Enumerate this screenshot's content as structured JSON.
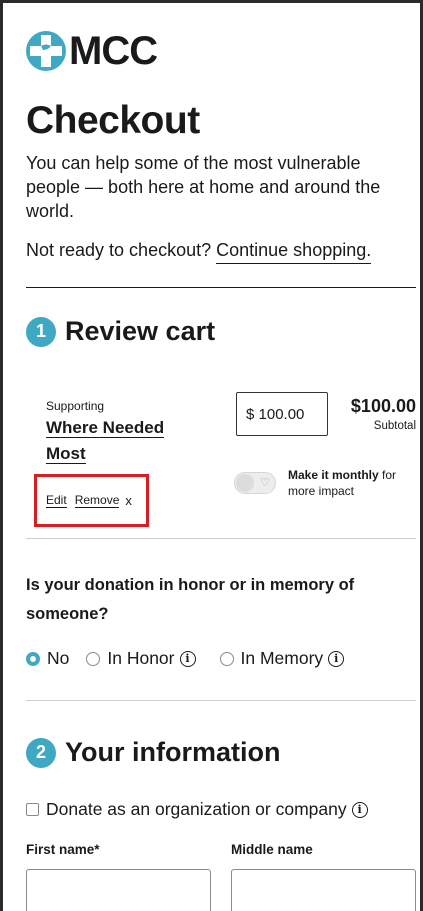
{
  "brand": {
    "name": "MCC",
    "logo_icon": "mcc-dove-cross-icon",
    "accent_color": "#3fa9c4",
    "highlight_color": "#d81e24"
  },
  "page": {
    "title": "Checkout",
    "intro": "You can help some of the most vulnerable people — both here at home and around the world.",
    "not_ready_text": "Not ready to checkout?",
    "continue_link": "Continue shopping."
  },
  "review_cart": {
    "step_number": "1",
    "title": "Review cart",
    "item": {
      "supporting_label": "Supporting",
      "fund_name": "Where Needed Most",
      "amount_input": "$ 100.00",
      "amount_total": "$100.00",
      "subtotal_label": "Subtotal",
      "edit_label": "Edit",
      "remove_label": "Remove",
      "remove_x": "x",
      "monthly_toggle": {
        "on": false,
        "icon": "heart-icon"
      },
      "monthly_bold": "Make it monthly",
      "monthly_rest": " for more impact"
    }
  },
  "tribute": {
    "question": "Is your donation in honor or in memory of someone?",
    "options": [
      {
        "label": "No",
        "checked": true,
        "info": false
      },
      {
        "label": "In Honor",
        "checked": false,
        "info": true
      },
      {
        "label": "In Memory",
        "checked": false,
        "info": true
      }
    ],
    "info_glyph": "i"
  },
  "your_information": {
    "step_number": "2",
    "title": "Your information",
    "org_checkbox_label": "Donate as an organization or company",
    "first_name_label": "First name*",
    "middle_name_label": "Middle name",
    "first_name_value": "",
    "middle_name_value": ""
  }
}
